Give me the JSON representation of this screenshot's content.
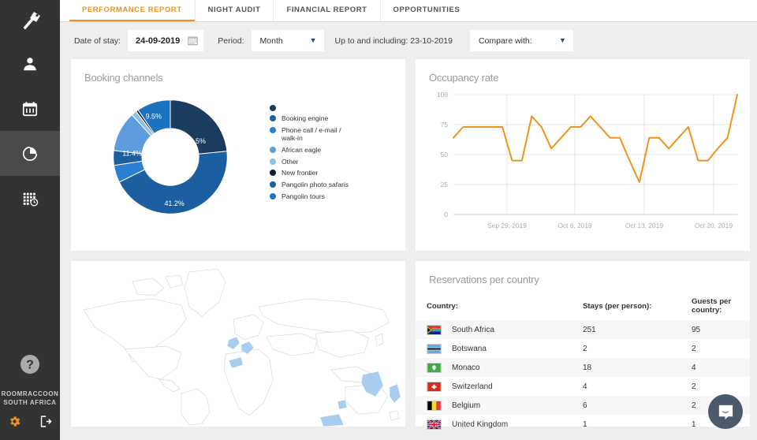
{
  "sidebar": {
    "logo_icon": "raccoon-logo-icon",
    "items": [
      {
        "icon": "person-icon",
        "name": "guests"
      },
      {
        "icon": "calendar-icon",
        "name": "calendar"
      },
      {
        "icon": "pie-chart-icon",
        "name": "reports",
        "active": true
      },
      {
        "icon": "grid-clock-icon",
        "name": "housekeeping"
      }
    ],
    "help_icon": "help-question-icon",
    "brand_line1": "ROOMRACCOON",
    "brand_line2": "SOUTH AFRICA",
    "settings_icon": "gear-icon",
    "logout_icon": "logout-icon",
    "accent": "#f0921e"
  },
  "tabs": [
    {
      "label": "PERFORMANCE REPORT",
      "active": true
    },
    {
      "label": "NIGHT AUDIT",
      "active": false
    },
    {
      "label": "FINANCIAL REPORT",
      "active": false
    },
    {
      "label": "OPPORTUNITIES",
      "active": false
    }
  ],
  "filters": {
    "date_label": "Date of stay:",
    "date_value": "24-09-2019",
    "calendar_icon": "calendar-icon",
    "period_label": "Period:",
    "period_value": "Month",
    "upto_text": "Up to and including: 23-10-2019",
    "compare_value": "Compare with:",
    "chevron_icon": "chevron-down-icon"
  },
  "cards": {
    "booking_title": "Booking channels",
    "occupancy_title": "Occupancy rate",
    "country_title": "Reservations per country"
  },
  "country_table": {
    "headers": [
      "Country:",
      "Stays (per person):",
      "Guests per country:"
    ],
    "rows": [
      {
        "flag": "za",
        "country": "South Africa",
        "stays": "251",
        "guests": "95"
      },
      {
        "flag": "bw",
        "country": "Botswana",
        "stays": "2",
        "guests": "2"
      },
      {
        "flag": "mc",
        "country": "Monaco",
        "stays": "18",
        "guests": "4"
      },
      {
        "flag": "ch",
        "country": "Switzerland",
        "stays": "4",
        "guests": "2"
      },
      {
        "flag": "be",
        "country": "Belgium",
        "stays": "6",
        "guests": "2"
      },
      {
        "flag": "gb",
        "country": "United Kingdom",
        "stays": "1",
        "guests": "1"
      }
    ]
  },
  "map": {
    "highlighted_countries": [
      "United Kingdom",
      "Belgium",
      "Netherlands",
      "Germany",
      "France",
      "Spain",
      "Portugal",
      "India",
      "Thailand",
      "Kenya",
      "South Africa",
      "Zimbabwe"
    ],
    "highlight_color": "#a8cdef",
    "outline_color": "#d9d9d9"
  },
  "intercom": {
    "icon": "chat-bubble-icon",
    "color": "#4b5a6b"
  },
  "chart_data": [
    {
      "type": "pie",
      "title": "Booking channels",
      "donut": true,
      "legend_position": "right",
      "labels": [
        "",
        "Booking engine",
        "Phone call / e-mail / walk-in",
        "African eagle",
        "Other",
        "New frontier",
        "Pangolin photo safaris",
        "Pangolin tours"
      ],
      "values": [
        26.5,
        41.2,
        11.4,
        9.5,
        1.6,
        0.7,
        4.2,
        4.9
      ],
      "displayed_labels": [
        "26.5%",
        "41.2%",
        "11.4%",
        "9.5%"
      ],
      "colors": [
        "#1a3c5e",
        "#1b5fa0",
        "#5e9ddd",
        "#1d72c0",
        "#8dc0e8",
        "#0d2238",
        "#1b5fa0",
        "#2a7fd0"
      ]
    },
    {
      "type": "line",
      "title": "Occupancy rate",
      "xlabel": "",
      "ylabel": "",
      "ylim": [
        0,
        100
      ],
      "yticks": [
        0,
        25,
        50,
        75,
        100
      ],
      "grid": true,
      "line_color": "#f0921e",
      "tick_labels": [
        "Sep 29, 2019",
        "Oct 6, 2019",
        "Oct 13, 2019",
        "Oct 20, 2019"
      ],
      "x": [
        "Sep 24, 2019",
        "Sep 25, 2019",
        "Sep 26, 2019",
        "Sep 27, 2019",
        "Sep 28, 2019",
        "Sep 29, 2019",
        "Sep 30, 2019",
        "Oct 1, 2019",
        "Oct 2, 2019",
        "Oct 3, 2019",
        "Oct 4, 2019",
        "Oct 5, 2019",
        "Oct 6, 2019",
        "Oct 7, 2019",
        "Oct 8, 2019",
        "Oct 9, 2019",
        "Oct 10, 2019",
        "Oct 11, 2019",
        "Oct 12, 2019",
        "Oct 13, 2019",
        "Oct 14, 2019",
        "Oct 15, 2019",
        "Oct 16, 2019",
        "Oct 17, 2019",
        "Oct 18, 2019",
        "Oct 19, 2019",
        "Oct 20, 2019",
        "Oct 21, 2019",
        "Oct 22, 2019",
        "Oct 23, 2019"
      ],
      "values": [
        64,
        73,
        73,
        73,
        73,
        73,
        45,
        45,
        82,
        73,
        55,
        64,
        73,
        73,
        82,
        73,
        64,
        64,
        45,
        27,
        64,
        64,
        55,
        64,
        73,
        45,
        45,
        55,
        64,
        100
      ]
    }
  ]
}
